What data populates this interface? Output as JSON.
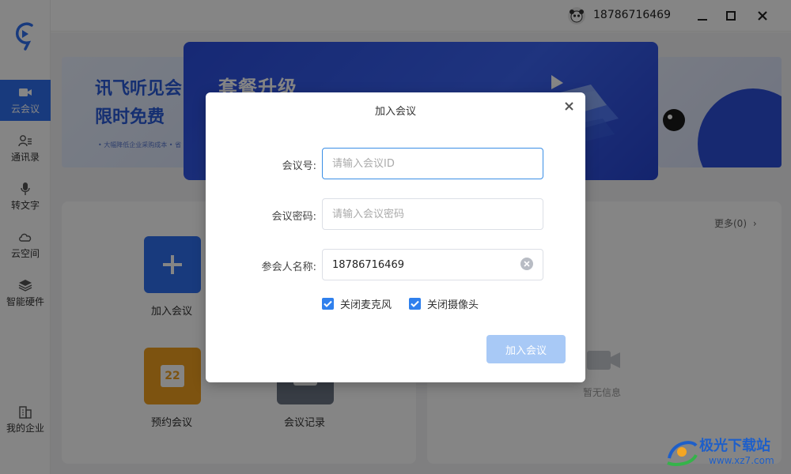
{
  "sidebar": {
    "items": [
      {
        "label": "云会议",
        "icon": "video-camera-icon"
      },
      {
        "label": "通讯录",
        "icon": "contacts-icon"
      },
      {
        "label": "转文字",
        "icon": "microphone-icon"
      },
      {
        "label": "云空间",
        "icon": "cloud-icon"
      },
      {
        "label": "智能硬件",
        "icon": "layers-icon"
      }
    ],
    "bottom_item": {
      "label": "我的企业",
      "icon": "building-icon"
    }
  },
  "topbar": {
    "user_phone": "18786716469"
  },
  "banners": {
    "left_line1": "讯飞听见会",
    "left_line2": "限时免费",
    "left_caption": "• 大幅降低企业采购成本 • 省",
    "center_title": "套餐升级"
  },
  "quick_actions": [
    {
      "label": "加入会议",
      "icon": "plus-icon"
    },
    {
      "label": "预约会议",
      "icon": "calendar-icon",
      "day": "22"
    },
    {
      "label": "会议记录",
      "icon": "record-icon"
    }
  ],
  "schedule_panel": {
    "more_label": "更多(0)",
    "empty_label": "暂无信息"
  },
  "dialog": {
    "title": "加入会议",
    "meeting_id_label": "会议号:",
    "meeting_id_placeholder": "请输入会议ID",
    "password_label": "会议密码:",
    "password_placeholder": "请输入会议密码",
    "name_label": "参会人名称:",
    "name_value": "18786716469",
    "mute_mic_label": "关闭麦克风",
    "mute_mic_checked": true,
    "camera_off_label": "关闭摄像头",
    "camera_off_checked": true,
    "submit_label": "加入会议"
  },
  "watermark": {
    "title": "极光下载站",
    "url": "www.xz7.com"
  },
  "colors": {
    "accent": "#2f6ff0",
    "checkbox": "#2f80ed",
    "submit_disabled": "#a8c9f6",
    "focus_border": "#3a8ee6"
  }
}
